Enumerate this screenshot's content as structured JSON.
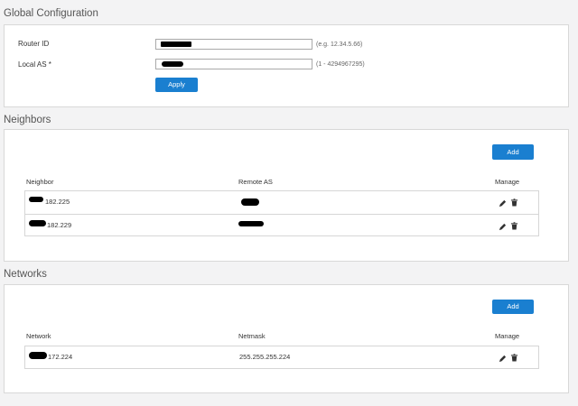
{
  "global": {
    "title": "Global Configuration",
    "router_id_label": "Router ID",
    "router_id_hint": "(e.g. 12.34.5.66)",
    "local_as_label": "Local AS *",
    "local_as_hint": "(1 - 4294967295)",
    "apply_label": "Apply"
  },
  "neighbors": {
    "title": "Neighbors",
    "add_label": "Add",
    "columns": [
      "Neighbor",
      "Remote AS",
      "Manage"
    ],
    "rows": [
      {
        "neighbor": "182.225"
      },
      {
        "neighbor": "182.229"
      }
    ]
  },
  "networks": {
    "title": "Networks",
    "add_label": "Add",
    "columns": [
      "Network",
      "Netmask",
      "Manage"
    ],
    "rows": [
      {
        "network": "172.224",
        "netmask": "255.255.255.224"
      }
    ]
  },
  "colors": {
    "accent": "#1a7fd0",
    "panel_border": "#d8d8d8",
    "background": "#f3f3f4"
  },
  "icons": [
    "pencil-icon",
    "trash-icon"
  ]
}
